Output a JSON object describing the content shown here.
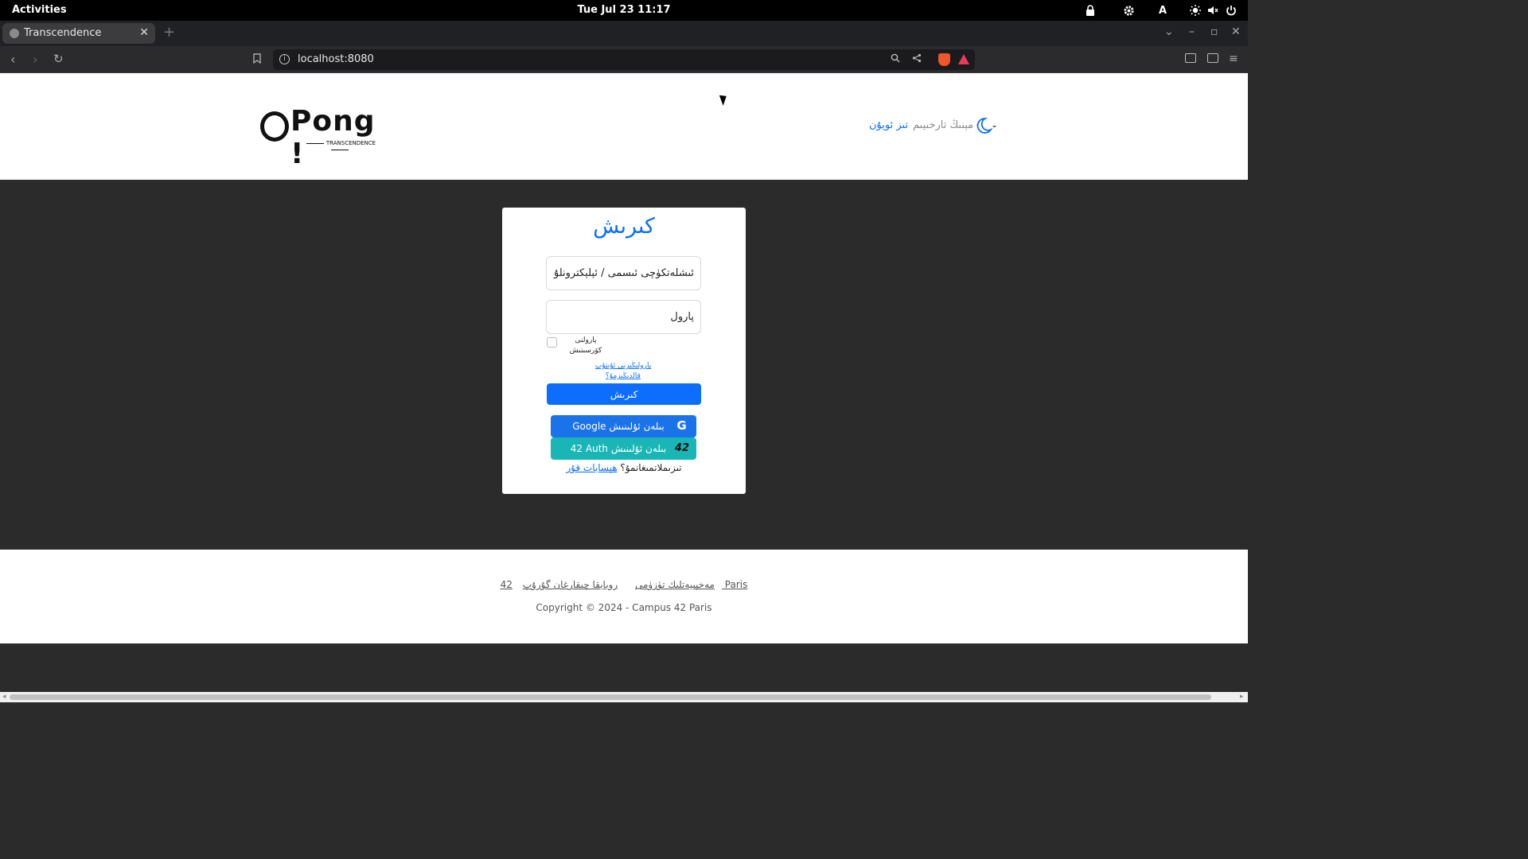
{
  "system": {
    "activities": "Activities",
    "clock": "Tue Jul 23  11:17",
    "tray_icons": [
      "lock-icon",
      "settings-icon",
      "keyboard-layout-icon",
      "brightness-icon",
      "volume-icon",
      "power-icon"
    ],
    "keyboard_layout": "A"
  },
  "browser": {
    "tab_title": "Transcendence",
    "url": "localhost:8080",
    "new_tab": "+",
    "close": "✕"
  },
  "header": {
    "logo_word": "Pong !",
    "logo_sub": "TRANSCENDENCE",
    "nav_link": "تىز ئويۇن",
    "nav_lang": "مېنىڭ تارخىيىم"
  },
  "login": {
    "title": "كىرىش",
    "username_placeholder": "ئىشلەتكۈچى ئىسمى / ئېلېكترونلۇق خەت",
    "password_placeholder": "پارول",
    "show_password": "پارولنى كۆرسىتىش",
    "forgot_password": "پارولىڭىزنى ئۇنتۇپ قالدىڭىزمۇ؟",
    "submit": "كىرىش",
    "google": "Google بىلەن ئۇلىنىش",
    "auth42": "42 Auth بىلەن ئۇلىنىش",
    "auth42_logo": "42",
    "signup_prompt": "تىزىملاتمىغانمۇ؟",
    "signup_link": "ھېسابات قۇر"
  },
  "footer": {
    "links": [
      "42 Paris",
      "روبابقا چىقارغان گۇرۇپ",
      "مەخپىيەتلىك تۈزۈمى"
    ],
    "copyright": "Copyright © 2024 - Campus 42 Paris"
  },
  "colors": {
    "accent": "#0d6efd",
    "google": "#1a73e8",
    "auth42": "#1ab6b6",
    "page_bg": "#2b2b2b"
  }
}
